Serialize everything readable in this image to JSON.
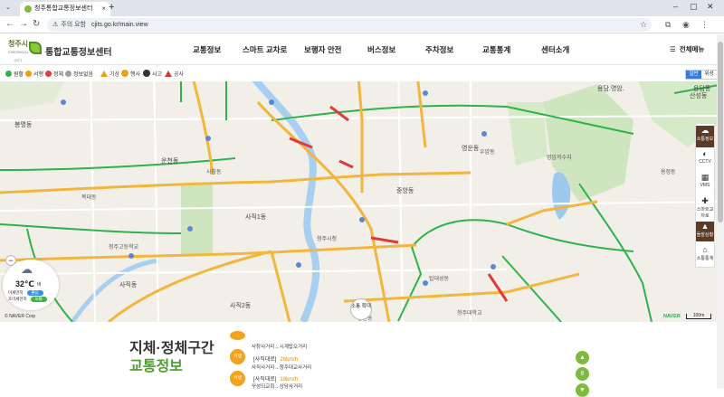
{
  "browser": {
    "tab_title": "청주통합교통정보센터",
    "new_tab": "+",
    "url": "cjits.go.kr/main.view",
    "security_label": "주의 요함"
  },
  "header": {
    "city_name": "청주시",
    "city_sub": "CHEONGJU CITY",
    "site_title": "통합교통정보센터",
    "nav": [
      "교통정보",
      "스마트 교차로",
      "보행자 안전",
      "버스정보",
      "주차정보",
      "교통통계",
      "센터소개"
    ],
    "all_menu": "전체메뉴"
  },
  "legend": {
    "items": [
      "원활",
      "서행",
      "정체",
      "정보없음",
      "기상",
      "행사",
      "사고",
      "공사"
    ],
    "colors": {
      "smooth": "#2db34a",
      "slow": "#f29a1f",
      "jam": "#e03a3a",
      "none": "#9e9e9e"
    }
  },
  "map": {
    "type_buttons": [
      "일반",
      "위성"
    ],
    "labels": [
      "용담동",
      "산성동",
      "용담.명암.",
      "용정동",
      "사직1동",
      "사직2동",
      "사직동",
      "중앙동",
      "영운동",
      "우암동",
      "사창동",
      "성안동",
      "탑대성동",
      "청주대학교",
      "청주시청",
      "청주고등학교",
      "봉명동",
      "복대동",
      "운천동",
      "명암저수지"
    ],
    "side_panel": [
      "소통정보",
      "CCTV",
      "VMS",
      "스마트교차로",
      "돌발상황",
      "소통통계"
    ],
    "zoom_label": "소통\n확대",
    "scale": "100m",
    "attribution": "© NAVER Corp",
    "naver": "NAVER",
    "weather": {
      "temp": "32℃",
      "condition": "비",
      "rows": [
        {
          "label": "미세먼지",
          "value": "좋음",
          "color": "#3a8ee6"
        },
        {
          "label": "초미세먼지",
          "value": "보통",
          "color": "#3db34a"
        }
      ]
    }
  },
  "content": {
    "title_line1": "지체·정체구간",
    "title_line2": "교통정보",
    "entries": [
      {
        "route": "사창사거리→시계탑오거리"
      },
      {
        "tag": "서행",
        "name": "[사직대로]",
        "speed": "26km/h",
        "route": "사직사거리→청주대교사거리"
      },
      {
        "tag": "서행",
        "name": "[사직대로]",
        "speed": "18km/h",
        "route": "꾸성되교회→상당사거리"
      }
    ],
    "controls": [
      "▲",
      "Ⅱ",
      "▼"
    ]
  }
}
